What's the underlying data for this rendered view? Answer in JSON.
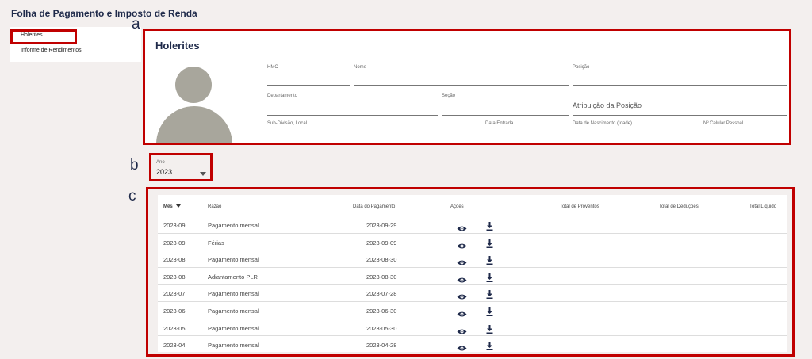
{
  "page": {
    "title": "Folha de Pagamento e Imposto de Renda"
  },
  "sidebar": {
    "items": [
      {
        "label": "Holerites"
      },
      {
        "label": "Informe de Rendimentos"
      }
    ]
  },
  "annotations": {
    "a": "a",
    "b": "b",
    "c": "c"
  },
  "colors": {
    "annotation_red": "#c00000",
    "title_navy": "#1f2a4a",
    "avatar_gray": "#a8a69c"
  },
  "profile": {
    "title": "Holerites",
    "fields": {
      "hmc": {
        "label": "HMC",
        "value": ""
      },
      "name": {
        "label": "Nome",
        "value": ""
      },
      "position": {
        "label": "Posição",
        "value": ""
      },
      "department": {
        "label": "Departamento",
        "value": ""
      },
      "section": {
        "label": "Seção",
        "value": ""
      },
      "position_attribution": {
        "label": "",
        "value": "Atribuição da Posição"
      },
      "subdivision": {
        "label": "Sub-Divisão, Local",
        "value": ""
      },
      "entry_date": {
        "label": "Data Entrada",
        "value": ""
      },
      "birth_date": {
        "label": "Data de Nascimento (Idade)",
        "value": ""
      },
      "cell": {
        "label": "Nº Celular Pessoal",
        "value": ""
      }
    }
  },
  "year_filter": {
    "label": "Ano",
    "value": "2023",
    "icon": "chevron-down-icon"
  },
  "table": {
    "headers": {
      "month": "Mês",
      "reason": "Razão",
      "payment_date": "Data do Pagamento",
      "actions": "Ações",
      "total_earnings": "Total de Proventos",
      "total_deductions": "Total de Deduções",
      "total_net": "Total Líquido"
    },
    "icons": {
      "view": "eye-icon",
      "download": "download-icon",
      "sort": "sort-desc-icon"
    },
    "rows": [
      {
        "month": "2023-09",
        "reason": "Pagamento mensal",
        "date": "2023-09-29"
      },
      {
        "month": "2023-09",
        "reason": "Férias",
        "date": "2023-09-09"
      },
      {
        "month": "2023-08",
        "reason": "Pagamento mensal",
        "date": "2023-08-30"
      },
      {
        "month": "2023-08",
        "reason": "Adiantamento PLR",
        "date": "2023-08-30"
      },
      {
        "month": "2023-07",
        "reason": "Pagamento mensal",
        "date": "2023-07-28"
      },
      {
        "month": "2023-06",
        "reason": "Pagamento mensal",
        "date": "2023-06-30"
      },
      {
        "month": "2023-05",
        "reason": "Pagamento mensal",
        "date": "2023-05-30"
      },
      {
        "month": "2023-04",
        "reason": "Pagamento mensal",
        "date": "2023-04-28"
      }
    ]
  }
}
